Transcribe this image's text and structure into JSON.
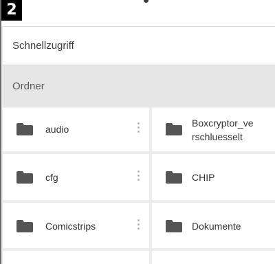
{
  "badge": "2",
  "sections": {
    "quick_access": "Schnellzugriff",
    "folders": "Ordner"
  },
  "folders": [
    {
      "name": "audio",
      "icon": "folder-icon"
    },
    {
      "name": "Boxcryptor_verschluesselt",
      "name_line1": "Boxcryptor_ve",
      "name_line2": "rschluesselt",
      "icon": "folder-icon"
    },
    {
      "name": "cfg",
      "icon": "folder-icon"
    },
    {
      "name": "CHIP",
      "icon": "folder-icon"
    },
    {
      "name": "Comicstrips",
      "icon": "folder-icon"
    },
    {
      "name": "Dokumente",
      "icon": "folder-icon"
    }
  ],
  "colors": {
    "folder_icon": "#555555",
    "section_header_bg": "#e6e6e6",
    "tile_bg": "#ffffff",
    "grid_gap": "#ececec"
  }
}
